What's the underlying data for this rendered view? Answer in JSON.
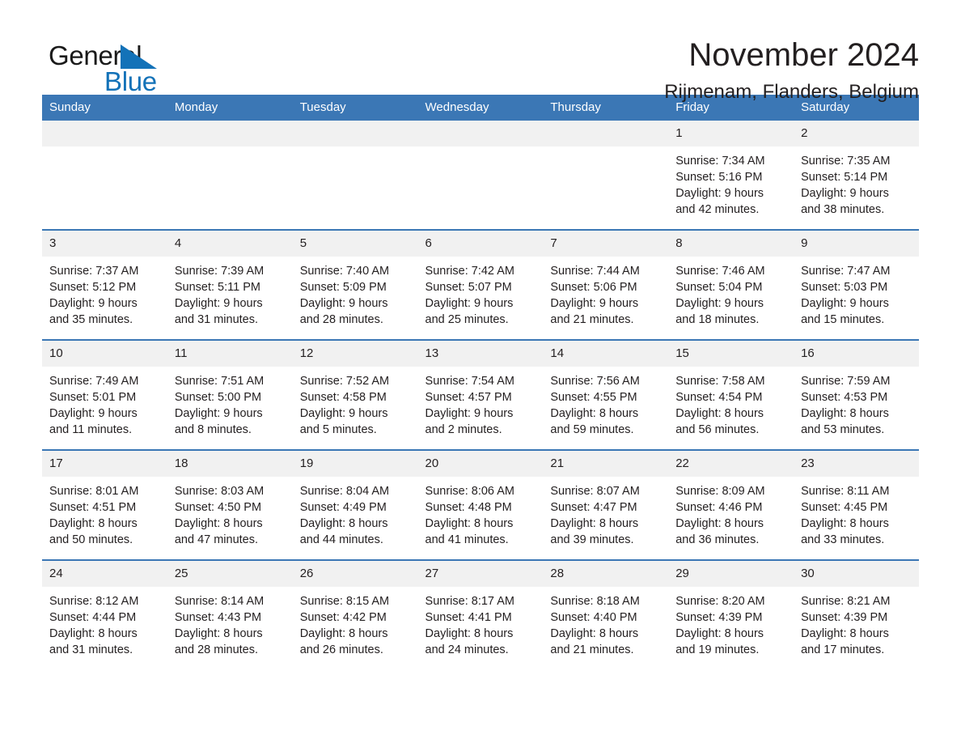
{
  "brand": {
    "word_one": "General",
    "word_two": "Blue",
    "triangle_icon": "brand-triangle-icon",
    "colors": {
      "blue": "#1372b8",
      "black": "#1a1a1a"
    }
  },
  "header": {
    "title": "November 2024",
    "subtitle": "Rijmenam, Flanders, Belgium"
  },
  "theme": {
    "header_blue": "#3b77b5",
    "daynum_band": "#f1f1f1",
    "text": "#231f20",
    "cell_background": "#ffffff"
  },
  "calendar": {
    "weekdays": [
      "Sunday",
      "Monday",
      "Tuesday",
      "Wednesday",
      "Thursday",
      "Friday",
      "Saturday"
    ],
    "weeks": [
      [
        {
          "day": "",
          "sunrise": "",
          "sunset": "",
          "daylight_line1": "",
          "daylight_line2": ""
        },
        {
          "day": "",
          "sunrise": "",
          "sunset": "",
          "daylight_line1": "",
          "daylight_line2": ""
        },
        {
          "day": "",
          "sunrise": "",
          "sunset": "",
          "daylight_line1": "",
          "daylight_line2": ""
        },
        {
          "day": "",
          "sunrise": "",
          "sunset": "",
          "daylight_line1": "",
          "daylight_line2": ""
        },
        {
          "day": "",
          "sunrise": "",
          "sunset": "",
          "daylight_line1": "",
          "daylight_line2": ""
        },
        {
          "day": "1",
          "sunrise": "Sunrise: 7:34 AM",
          "sunset": "Sunset: 5:16 PM",
          "daylight_line1": "Daylight: 9 hours",
          "daylight_line2": "and 42 minutes."
        },
        {
          "day": "2",
          "sunrise": "Sunrise: 7:35 AM",
          "sunset": "Sunset: 5:14 PM",
          "daylight_line1": "Daylight: 9 hours",
          "daylight_line2": "and 38 minutes."
        }
      ],
      [
        {
          "day": "3",
          "sunrise": "Sunrise: 7:37 AM",
          "sunset": "Sunset: 5:12 PM",
          "daylight_line1": "Daylight: 9 hours",
          "daylight_line2": "and 35 minutes."
        },
        {
          "day": "4",
          "sunrise": "Sunrise: 7:39 AM",
          "sunset": "Sunset: 5:11 PM",
          "daylight_line1": "Daylight: 9 hours",
          "daylight_line2": "and 31 minutes."
        },
        {
          "day": "5",
          "sunrise": "Sunrise: 7:40 AM",
          "sunset": "Sunset: 5:09 PM",
          "daylight_line1": "Daylight: 9 hours",
          "daylight_line2": "and 28 minutes."
        },
        {
          "day": "6",
          "sunrise": "Sunrise: 7:42 AM",
          "sunset": "Sunset: 5:07 PM",
          "daylight_line1": "Daylight: 9 hours",
          "daylight_line2": "and 25 minutes."
        },
        {
          "day": "7",
          "sunrise": "Sunrise: 7:44 AM",
          "sunset": "Sunset: 5:06 PM",
          "daylight_line1": "Daylight: 9 hours",
          "daylight_line2": "and 21 minutes."
        },
        {
          "day": "8",
          "sunrise": "Sunrise: 7:46 AM",
          "sunset": "Sunset: 5:04 PM",
          "daylight_line1": "Daylight: 9 hours",
          "daylight_line2": "and 18 minutes."
        },
        {
          "day": "9",
          "sunrise": "Sunrise: 7:47 AM",
          "sunset": "Sunset: 5:03 PM",
          "daylight_line1": "Daylight: 9 hours",
          "daylight_line2": "and 15 minutes."
        }
      ],
      [
        {
          "day": "10",
          "sunrise": "Sunrise: 7:49 AM",
          "sunset": "Sunset: 5:01 PM",
          "daylight_line1": "Daylight: 9 hours",
          "daylight_line2": "and 11 minutes."
        },
        {
          "day": "11",
          "sunrise": "Sunrise: 7:51 AM",
          "sunset": "Sunset: 5:00 PM",
          "daylight_line1": "Daylight: 9 hours",
          "daylight_line2": "and 8 minutes."
        },
        {
          "day": "12",
          "sunrise": "Sunrise: 7:52 AM",
          "sunset": "Sunset: 4:58 PM",
          "daylight_line1": "Daylight: 9 hours",
          "daylight_line2": "and 5 minutes."
        },
        {
          "day": "13",
          "sunrise": "Sunrise: 7:54 AM",
          "sunset": "Sunset: 4:57 PM",
          "daylight_line1": "Daylight: 9 hours",
          "daylight_line2": "and 2 minutes."
        },
        {
          "day": "14",
          "sunrise": "Sunrise: 7:56 AM",
          "sunset": "Sunset: 4:55 PM",
          "daylight_line1": "Daylight: 8 hours",
          "daylight_line2": "and 59 minutes."
        },
        {
          "day": "15",
          "sunrise": "Sunrise: 7:58 AM",
          "sunset": "Sunset: 4:54 PM",
          "daylight_line1": "Daylight: 8 hours",
          "daylight_line2": "and 56 minutes."
        },
        {
          "day": "16",
          "sunrise": "Sunrise: 7:59 AM",
          "sunset": "Sunset: 4:53 PM",
          "daylight_line1": "Daylight: 8 hours",
          "daylight_line2": "and 53 minutes."
        }
      ],
      [
        {
          "day": "17",
          "sunrise": "Sunrise: 8:01 AM",
          "sunset": "Sunset: 4:51 PM",
          "daylight_line1": "Daylight: 8 hours",
          "daylight_line2": "and 50 minutes."
        },
        {
          "day": "18",
          "sunrise": "Sunrise: 8:03 AM",
          "sunset": "Sunset: 4:50 PM",
          "daylight_line1": "Daylight: 8 hours",
          "daylight_line2": "and 47 minutes."
        },
        {
          "day": "19",
          "sunrise": "Sunrise: 8:04 AM",
          "sunset": "Sunset: 4:49 PM",
          "daylight_line1": "Daylight: 8 hours",
          "daylight_line2": "and 44 minutes."
        },
        {
          "day": "20",
          "sunrise": "Sunrise: 8:06 AM",
          "sunset": "Sunset: 4:48 PM",
          "daylight_line1": "Daylight: 8 hours",
          "daylight_line2": "and 41 minutes."
        },
        {
          "day": "21",
          "sunrise": "Sunrise: 8:07 AM",
          "sunset": "Sunset: 4:47 PM",
          "daylight_line1": "Daylight: 8 hours",
          "daylight_line2": "and 39 minutes."
        },
        {
          "day": "22",
          "sunrise": "Sunrise: 8:09 AM",
          "sunset": "Sunset: 4:46 PM",
          "daylight_line1": "Daylight: 8 hours",
          "daylight_line2": "and 36 minutes."
        },
        {
          "day": "23",
          "sunrise": "Sunrise: 8:11 AM",
          "sunset": "Sunset: 4:45 PM",
          "daylight_line1": "Daylight: 8 hours",
          "daylight_line2": "and 33 minutes."
        }
      ],
      [
        {
          "day": "24",
          "sunrise": "Sunrise: 8:12 AM",
          "sunset": "Sunset: 4:44 PM",
          "daylight_line1": "Daylight: 8 hours",
          "daylight_line2": "and 31 minutes."
        },
        {
          "day": "25",
          "sunrise": "Sunrise: 8:14 AM",
          "sunset": "Sunset: 4:43 PM",
          "daylight_line1": "Daylight: 8 hours",
          "daylight_line2": "and 28 minutes."
        },
        {
          "day": "26",
          "sunrise": "Sunrise: 8:15 AM",
          "sunset": "Sunset: 4:42 PM",
          "daylight_line1": "Daylight: 8 hours",
          "daylight_line2": "and 26 minutes."
        },
        {
          "day": "27",
          "sunrise": "Sunrise: 8:17 AM",
          "sunset": "Sunset: 4:41 PM",
          "daylight_line1": "Daylight: 8 hours",
          "daylight_line2": "and 24 minutes."
        },
        {
          "day": "28",
          "sunrise": "Sunrise: 8:18 AM",
          "sunset": "Sunset: 4:40 PM",
          "daylight_line1": "Daylight: 8 hours",
          "daylight_line2": "and 21 minutes."
        },
        {
          "day": "29",
          "sunrise": "Sunrise: 8:20 AM",
          "sunset": "Sunset: 4:39 PM",
          "daylight_line1": "Daylight: 8 hours",
          "daylight_line2": "and 19 minutes."
        },
        {
          "day": "30",
          "sunrise": "Sunrise: 8:21 AM",
          "sunset": "Sunset: 4:39 PM",
          "daylight_line1": "Daylight: 8 hours",
          "daylight_line2": "and 17 minutes."
        }
      ]
    ]
  }
}
